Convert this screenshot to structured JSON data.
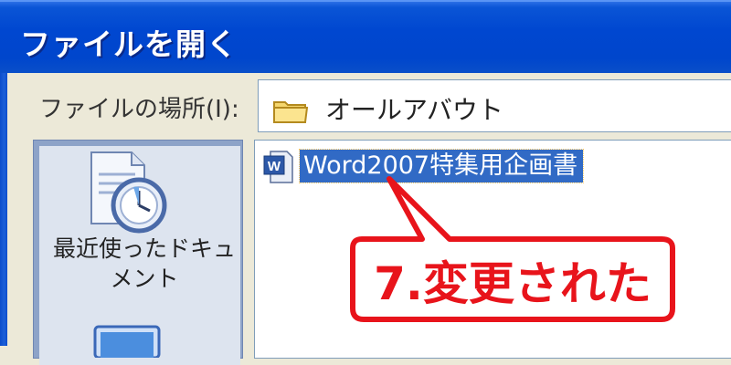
{
  "dialog": {
    "title": "ファイルを開く"
  },
  "look_in": {
    "label": "ファイルの場所(I):",
    "value": "オールアバウト",
    "icon": "folder-icon"
  },
  "places_bar": {
    "items": [
      {
        "label": "最近使ったドキュメント",
        "icon": "recent-documents-icon"
      },
      {
        "label": "",
        "icon": "desktop-icon"
      }
    ]
  },
  "file_list": {
    "items": [
      {
        "name": "Word2007特集用企画書",
        "icon": "word-document-icon",
        "selected": true
      }
    ]
  },
  "annotation": {
    "text": "7.変更された",
    "color": "#e8141b"
  },
  "colors": {
    "title_bar": "#0047d0",
    "selection": "#316ac5",
    "dialog_bg": "#ece9d8"
  }
}
